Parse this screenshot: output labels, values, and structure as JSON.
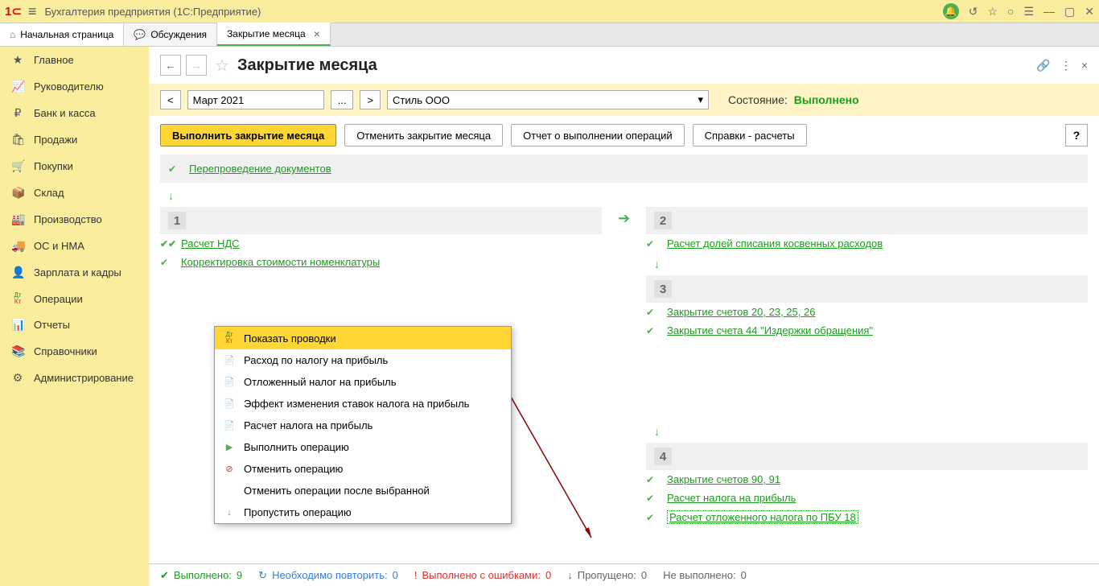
{
  "title": "Бухгалтерия предприятия  (1С:Предприятие)",
  "tabs": {
    "home": "Начальная страница",
    "discuss": "Обсуждения",
    "closing": "Закрытие месяца"
  },
  "sidebar": [
    {
      "icon": "★",
      "label": "Главное"
    },
    {
      "icon": "📈",
      "label": "Руководителю"
    },
    {
      "icon": "₽",
      "label": "Банк и касса"
    },
    {
      "icon": "🛍",
      "label": "Продажи"
    },
    {
      "icon": "🛒",
      "label": "Покупки"
    },
    {
      "icon": "📦",
      "label": "Склад"
    },
    {
      "icon": "🏭",
      "label": "Производство"
    },
    {
      "icon": "🚚",
      "label": "ОС и НМА"
    },
    {
      "icon": "👤",
      "label": "Зарплата и кадры"
    },
    {
      "icon": "Дт",
      "label": "Операции"
    },
    {
      "icon": "📊",
      "label": "Отчеты"
    },
    {
      "icon": "📚",
      "label": "Справочники"
    },
    {
      "icon": "⚙",
      "label": "Администрирование"
    }
  ],
  "page": {
    "title": "Закрытие месяца",
    "period": "Март 2021",
    "org": "Стиль ООО",
    "state_label": "Состояние:",
    "state_value": "Выполнено"
  },
  "actions": {
    "run": "Выполнить закрытие месяца",
    "cancel": "Отменить закрытие месяца",
    "report": "Отчет о выполнении операций",
    "refs": "Справки - расчеты"
  },
  "ops": {
    "reproc": "Перепроведение документов",
    "step1": {
      "num": "1",
      "nds": "Расчет НДС",
      "korr": "Корректировка стоимости номенклатуры"
    },
    "step2": {
      "num": "2",
      "kosv": "Расчет долей списания косвенных расходов"
    },
    "step3": {
      "num": "3",
      "zakr20": "Закрытие счетов 20, 23, 25, 26",
      "zakr44": "Закрытие счета 44 \"Издержки обращения\""
    },
    "step4": {
      "num": "4",
      "zakr90": "Закрытие счетов 90, 91",
      "nalog": "Расчет налога на прибыль",
      "pbu18": "Расчет отложенного налога по ПБУ 18"
    }
  },
  "context_menu": [
    {
      "icon": "dtkt",
      "label": "Показать проводки",
      "hl": true
    },
    {
      "icon": "doc",
      "label": "Расход по налогу на прибыль"
    },
    {
      "icon": "doc",
      "label": "Отложенный налог на прибыль"
    },
    {
      "icon": "doc",
      "label": "Эффект изменения ставок налога на прибыль"
    },
    {
      "icon": "doc",
      "label": "Расчет налога на прибыль"
    },
    {
      "icon": "run",
      "label": "Выполнить операцию"
    },
    {
      "icon": "cancel",
      "label": "Отменить операцию"
    },
    {
      "icon": "",
      "label": "Отменить операции после выбранной"
    },
    {
      "icon": "skip",
      "label": "Пропустить операцию"
    }
  ],
  "status": {
    "done_label": "Выполнено:",
    "done_val": "9",
    "repeat_label": "Необходимо повторить:",
    "repeat_val": "0",
    "errors_label": "Выполнено с ошибками:",
    "errors_val": "0",
    "skipped_label": "Пропущено:",
    "skipped_val": "0",
    "notdone_label": "Не выполнено:",
    "notdone_val": "0"
  }
}
